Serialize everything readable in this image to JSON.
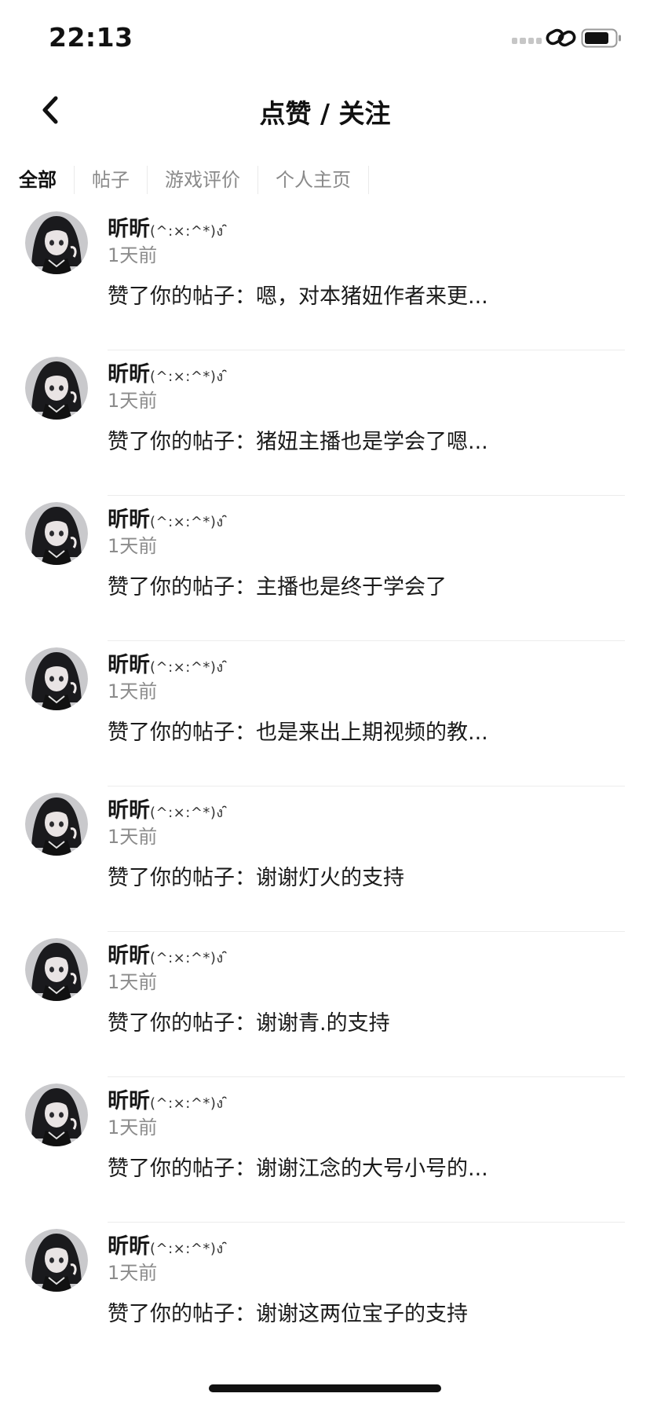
{
  "status_bar": {
    "time": "22:13"
  },
  "nav": {
    "title": "点赞 / 关注"
  },
  "tabs": [
    {
      "label": "全部",
      "active": true
    },
    {
      "label": "帖子",
      "active": false
    },
    {
      "label": "游戏评价",
      "active": false
    },
    {
      "label": "个人主页",
      "active": false
    }
  ],
  "notifications": [
    {
      "username": "昕昕",
      "kaomoji": "(^:×:^*)ง ̑̑",
      "time": "1天前",
      "content": "赞了你的帖子：嗯，对本猪妞作者来更..."
    },
    {
      "username": "昕昕",
      "kaomoji": "(^:×:^*)ง ̑̑",
      "time": "1天前",
      "content": "赞了你的帖子：猪妞主播也是学会了嗯..."
    },
    {
      "username": "昕昕",
      "kaomoji": "(^:×:^*)ง ̑̑",
      "time": "1天前",
      "content": "赞了你的帖子：主播也是终于学会了"
    },
    {
      "username": "昕昕",
      "kaomoji": "(^:×:^*)ง ̑̑",
      "time": "1天前",
      "content": "赞了你的帖子：也是来出上期视频的教..."
    },
    {
      "username": "昕昕",
      "kaomoji": "(^:×:^*)ง ̑̑",
      "time": "1天前",
      "content": "赞了你的帖子：谢谢灯火的支持"
    },
    {
      "username": "昕昕",
      "kaomoji": "(^:×:^*)ง ̑̑",
      "time": "1天前",
      "content": "赞了你的帖子：谢谢青.的支持"
    },
    {
      "username": "昕昕",
      "kaomoji": "(^:×:^*)ง ̑̑",
      "time": "1天前",
      "content": "赞了你的帖子：谢谢江念的大号小号的..."
    },
    {
      "username": "昕昕",
      "kaomoji": "(^:×:^*)ง ̑̑",
      "time": "1天前",
      "content": "赞了你的帖子：谢谢这两位宝子的支持"
    }
  ],
  "icons": {
    "back": "chevron-left-icon",
    "signal": "signal-icon",
    "link": "link-icon",
    "battery": "battery-icon"
  },
  "colors": {
    "text": "#161616",
    "secondary_text": "#8c8c8c",
    "divider": "#ececec",
    "background": "#ffffff"
  }
}
